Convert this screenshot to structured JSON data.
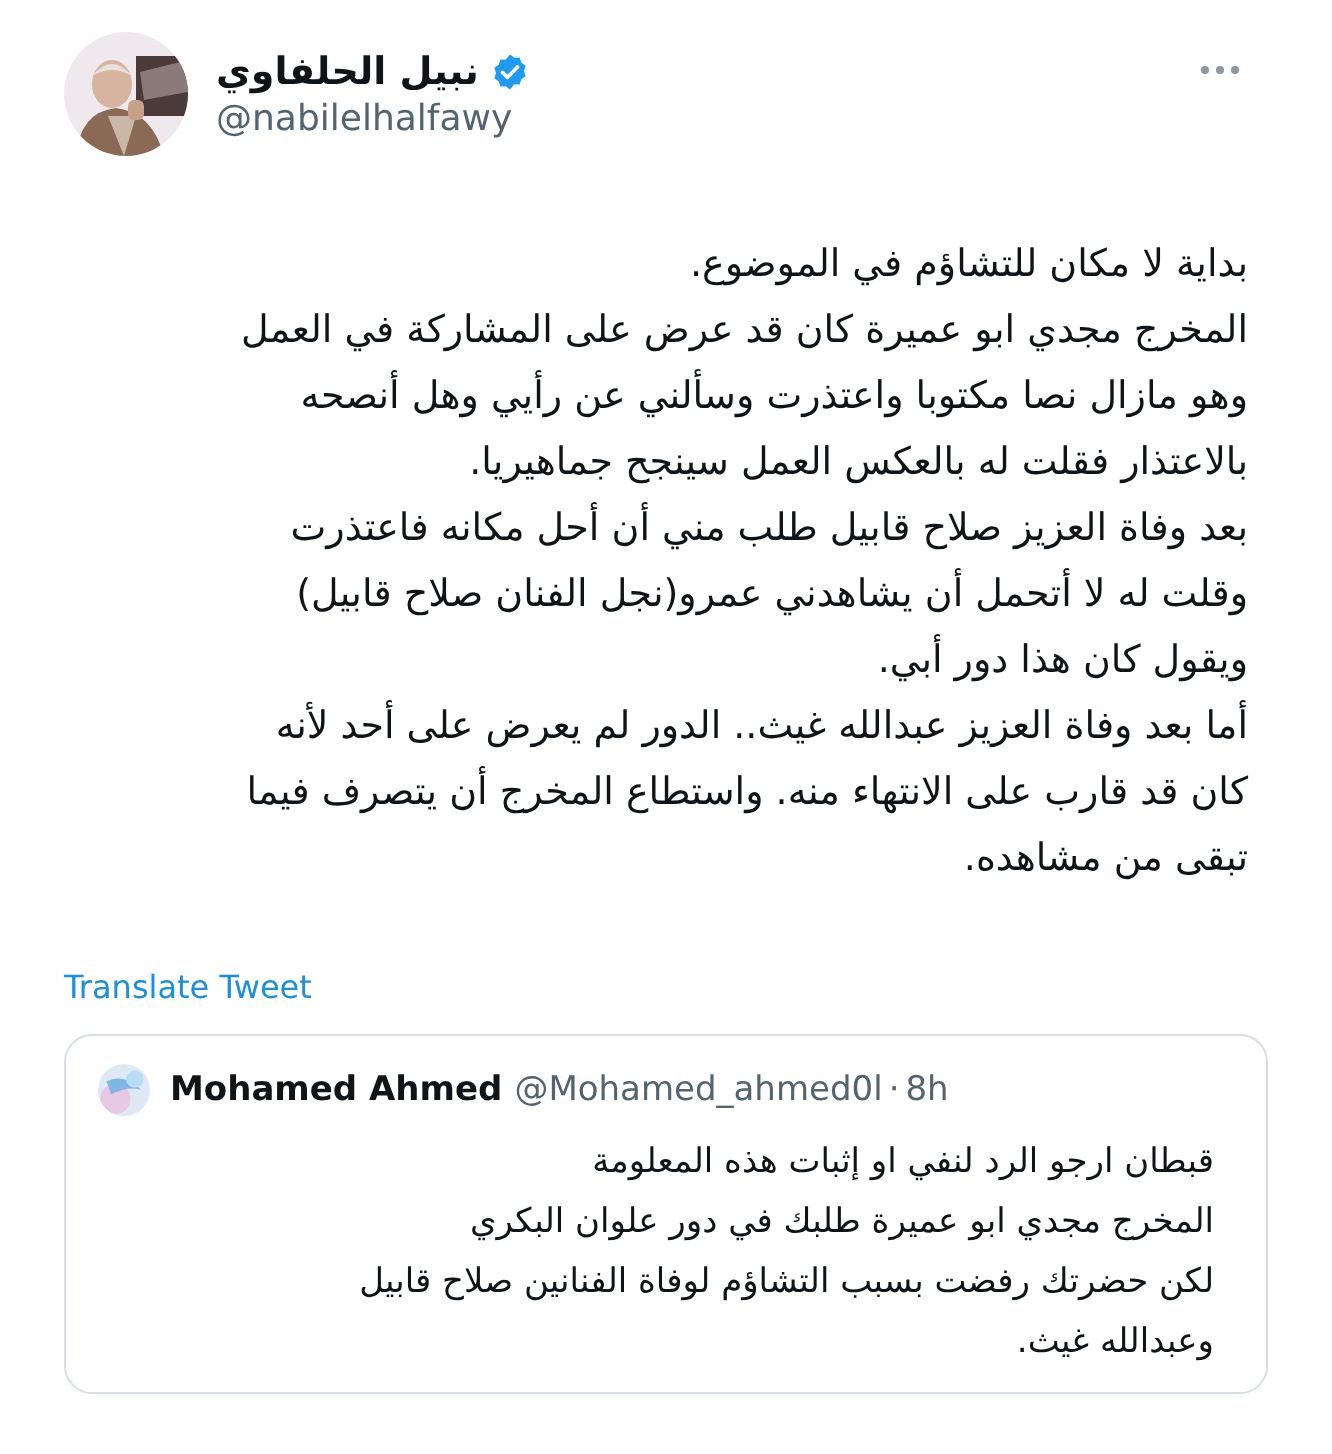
{
  "author": {
    "name": "نبيل الحلفاوي",
    "verified": true,
    "handle": "@nabilelhalfawy"
  },
  "tweet_lines": [
    "بداية لا مكان للتشاؤم في الموضوع.",
    "المخرج مجدي ابو عميرة كان قد عرض على المشاركة في العمل",
    "وهو مازال نصا مكتوبا واعتذرت وسألني عن رأيي وهل أنصحه",
    "بالاعتذار فقلت له بالعكس العمل سينجح جماهيريا.",
    "بعد وفاة العزيز صلاح قابيل طلب مني أن أحل مكانه فاعتذرت",
    "وقلت له لا أتحمل أن يشاهدني عمرو(نجل الفنان صلاح قابيل)",
    "ويقول كان هذا دور أبي.",
    "أما بعد وفاة العزيز عبدالله غيث.. الدور لم يعرض على أحد لأنه",
    "كان قد قارب على الانتهاء منه. واستطاع المخرج أن يتصرف فيما",
    "تبقى من مشاهده."
  ],
  "translate_link": "Translate Tweet",
  "quoted_tweet": {
    "name": "Mohamed Ahmed",
    "handle": "@Mohamed_ahmed0l",
    "separator": "·",
    "time": "8h",
    "lines": [
      "قبطان ارجو الرد لنفي او إثبات هذه المعلومة",
      "المخرج مجدي ابو عميرة طلبك في دور علوان البكري",
      "لكن حضرتك رفضت بسبب التشاؤم  لوفاة الفنانين صلاح قابيل",
      "وعبدالله غيث."
    ]
  }
}
